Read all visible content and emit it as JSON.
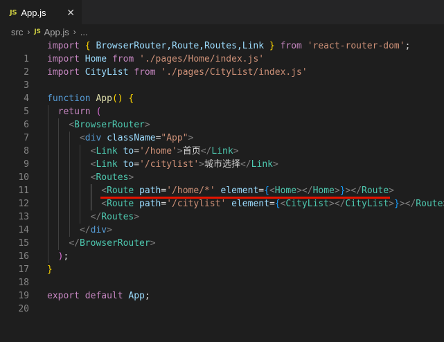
{
  "tab": {
    "icon": "js-file-icon",
    "icon_label": "JS",
    "title": "App.js",
    "close": "✕"
  },
  "breadcrumb": {
    "folder": "src",
    "icon_label": "JS",
    "file": "App.js",
    "trailing": "..."
  },
  "line_numbers": [
    "1",
    "2",
    "3",
    "4",
    "5",
    "6",
    "7",
    "8",
    "9",
    "10",
    "11",
    "12",
    "13",
    "14",
    "15",
    "16",
    "17",
    "18",
    "19",
    "20"
  ],
  "code": {
    "l1": {
      "import": "import",
      "open": "{",
      "names": " BrowserRouter,Route,Routes,Link ",
      "close": "}",
      "from": "from",
      "module": "'react-router-dom'",
      "semi": ";"
    },
    "l2": {
      "import": "import",
      "name": "Home",
      "from": "from",
      "module": "'./pages/Home/index.js'"
    },
    "l3": {
      "import": "import",
      "name": "CityList",
      "from": "from",
      "module": "'./pages/CityList/index.js'"
    },
    "l5": {
      "function": "function",
      "name": "App",
      "parens": "()",
      "brace": "{"
    },
    "l6": {
      "return": "return",
      "paren": "("
    },
    "l7": {
      "lt": "<",
      "tag": "BrowserRouter",
      "gt": ">"
    },
    "l8": {
      "lt": "<",
      "tag": "div",
      "attr": "className",
      "eq": "=",
      "val": "\"App\"",
      "gt": ">"
    },
    "l9": {
      "lt": "<",
      "tag": "Link",
      "attr": "to",
      "eq": "=",
      "val": "'/home'",
      "gt": ">",
      "text": "首页",
      "close_lt": "</",
      "close_tag": "Link",
      "close_gt": ">"
    },
    "l10": {
      "lt": "<",
      "tag": "Link",
      "attr": "to",
      "eq": "=",
      "val": "'/citylist'",
      "gt": ">",
      "text": "城市选择",
      "close_lt": "</",
      "close_tag": "Link",
      "close_gt": ">"
    },
    "l11": {
      "lt": "<",
      "tag": "Routes",
      "gt": ">"
    },
    "l12": {
      "lt": "<",
      "tag": "Route",
      "attr1": "path",
      "eq1": "=",
      "val1": "'/home/*'",
      "attr2": "element",
      "eq2": "=",
      "ob": "{",
      "ilt": "<",
      "itag": "Home",
      "igt": ">",
      "iclt": "</",
      "ictag": "Home",
      "icgt": ">",
      "cb": "}",
      "end_lt": "></",
      "end_tag": "Route",
      "end_gt": ">"
    },
    "l13": {
      "lt": "<",
      "tag": "Route",
      "attr1": "path",
      "eq1": "=",
      "val1": "'/citylist'",
      "attr2": "element",
      "eq2": "=",
      "ob": "{",
      "ilt": "<",
      "itag": "CityList",
      "igt": ">",
      "iclt": "</",
      "ictag": "CityList",
      "icgt": ">",
      "cb": "}",
      "end_lt": "></",
      "end_tag": "Route",
      "end_gt": ">"
    },
    "l14": {
      "lt": "</",
      "tag": "Routes",
      "gt": ">"
    },
    "l15": {
      "lt": "</",
      "tag": "div",
      "gt": ">"
    },
    "l16": {
      "lt": "</",
      "tag": "BrowserRouter",
      "gt": ">"
    },
    "l17": {
      "paren": ")",
      "semi": ";"
    },
    "l18": {
      "brace": "}"
    },
    "l20": {
      "export": "export",
      "default": "default",
      "name": "App",
      "semi": ";"
    }
  },
  "colors": {
    "background": "#1e1e1e",
    "tabbar": "#252526",
    "annotation_underline": "#e51400"
  }
}
